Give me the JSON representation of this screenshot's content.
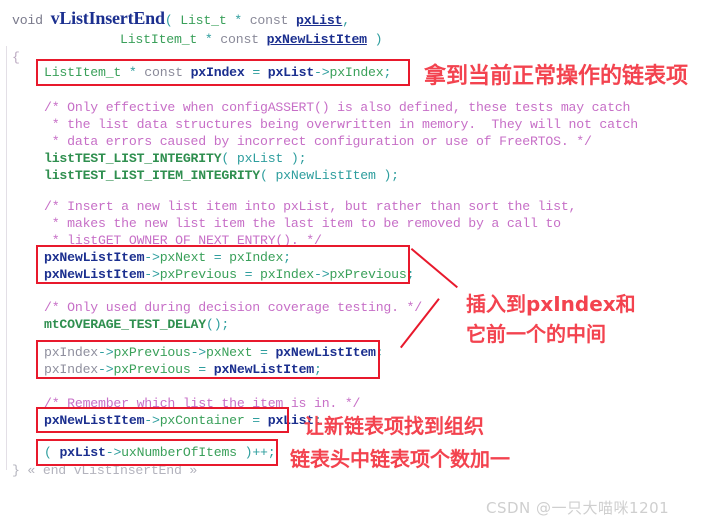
{
  "editor": {
    "language": "c",
    "function_name": "vListInsertEnd",
    "code_lines": [
      {
        "id": "sig1",
        "text": "void vListInsertEnd( List_t * const pxList,"
      },
      {
        "id": "sig2",
        "text": "                    ListItem_t * const pxNewListItem )"
      },
      {
        "id": "open",
        "text": "{"
      },
      {
        "id": "l1",
        "text": "    ListItem_t * const pxIndex = pxList->pxIndex;"
      },
      {
        "id": "c1a",
        "text": "    /* Only effective when configASSERT() is also defined, these tests may catch"
      },
      {
        "id": "c1b",
        "text": "     * the list data structures being overwritten in memory.  They will not catch"
      },
      {
        "id": "c1c",
        "text": "     * data errors caused by incorrect configuration or use of FreeRTOS. */"
      },
      {
        "id": "l2",
        "text": "    listTEST_LIST_INTEGRITY( pxList );"
      },
      {
        "id": "l3",
        "text": "    listTEST_LIST_ITEM_INTEGRITY( pxNewListItem );"
      },
      {
        "id": "c2a",
        "text": "    /* Insert a new list item into pxList, but rather than sort the list,"
      },
      {
        "id": "c2b",
        "text": "     * makes the new list item the last item to be removed by a call to"
      },
      {
        "id": "c2c",
        "text": "     * listGET_OWNER_OF_NEXT_ENTRY(). */"
      },
      {
        "id": "l4",
        "text": "    pxNewListItem->pxNext = pxIndex;"
      },
      {
        "id": "l5",
        "text": "    pxNewListItem->pxPrevious = pxIndex->pxPrevious;"
      },
      {
        "id": "c3",
        "text": "    /* Only used during decision coverage testing. */"
      },
      {
        "id": "l6",
        "text": "    mtCOVERAGE_TEST_DELAY();"
      },
      {
        "id": "l7",
        "text": "    pxIndex->pxPrevious->pxNext = pxNewListItem;"
      },
      {
        "id": "l8",
        "text": "    pxIndex->pxPrevious = pxNewListItem;"
      },
      {
        "id": "c4",
        "text": "    /* Remember which list the item is in. */"
      },
      {
        "id": "l9",
        "text": "    pxNewListItem->pxContainer = pxList;"
      },
      {
        "id": "l10",
        "text": "    ( pxList->uxNumberOfItems )++;"
      },
      {
        "id": "close",
        "text": "} « end vListInsertEnd »"
      }
    ],
    "tokens": {
      "kw_void": "void",
      "fn_name": "vListInsertEnd",
      "type_list_t": "List_t",
      "type_listitem_t": "ListItem_t",
      "kw_const": "const",
      "var_pxlist": "pxList",
      "var_pxnewlistitem": "pxNewListItem",
      "var_pxindex": "pxIndex",
      "member_pxindex": "pxIndex",
      "member_pxnext": "pxNext",
      "member_pxprevious": "pxPrevious",
      "member_pxcontainer": "pxContainer",
      "member_uxnumberofitems": "uxNumberOfItems",
      "macro_test_list": "listTEST_LIST_INTEGRITY",
      "macro_test_item": "listTEST_LIST_ITEM_INTEGRITY",
      "macro_coverage": "mtCOVERAGE_TEST_DELAY",
      "brace_open": "{",
      "end_marker": "} « end vListInsertEnd »"
    },
    "comments": {
      "c1_l1": "/* Only effective when configASSERT() is also defined, these tests may catch",
      "c1_l2": " * the list data structures being overwritten in memory.  They will not catch",
      "c1_l3": " * data errors caused by incorrect configuration or use of FreeRTOS. */",
      "c2_l1": "/* Insert a new list item into pxList, but rather than sort the list,",
      "c2_l2": " * makes the new list item the last item to be removed by a call to",
      "c2_l3": " * listGET_OWNER_OF_NEXT_ENTRY(). */",
      "c3_l1": "/* Only used during decision coverage testing. */",
      "c4_l1": "/* Remember which list the item is in. */"
    }
  },
  "annotations": [
    {
      "id": "a1",
      "text": "拿到当前正常操作的链表项"
    },
    {
      "id": "a2",
      "text": "插入到pxIndex和"
    },
    {
      "id": "a3",
      "text": "它前一个的中间"
    },
    {
      "id": "a4",
      "text": "让新链表项找到组织"
    },
    {
      "id": "a5",
      "text": "链表头中链表项个数加一"
    }
  ],
  "watermark": {
    "text": "CSDN @一只大喵咪1201"
  },
  "colors": {
    "annotation_red": "#f3434f",
    "box_red": "#e8192c",
    "type_green": "#3aa05a",
    "var_blue": "#1b2f8f",
    "comment_purple": "#c76fc7",
    "operator_teal": "#2e9e9e",
    "watermark_gray": "#cfcfcf",
    "background": "#ffffff"
  }
}
